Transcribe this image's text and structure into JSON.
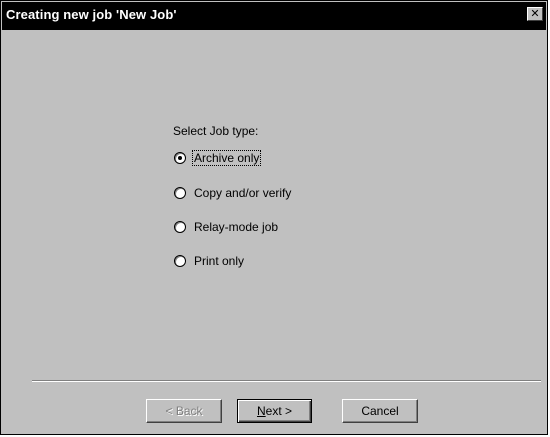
{
  "window": {
    "title": "Creating new job 'New Job'",
    "close_glyph": "✕"
  },
  "prompt": "Select Job type:",
  "job_types": [
    {
      "label": "Archive only",
      "selected": true
    },
    {
      "label": "Copy and/or verify",
      "selected": false
    },
    {
      "label": "Relay-mode job",
      "selected": false
    },
    {
      "label": "Print only",
      "selected": false
    }
  ],
  "buttons": {
    "back_label": "< Back",
    "next_label": "Next >",
    "cancel_label": "Cancel"
  },
  "colors": {
    "face": "#c0c0c0",
    "titlebar": "#000000"
  }
}
